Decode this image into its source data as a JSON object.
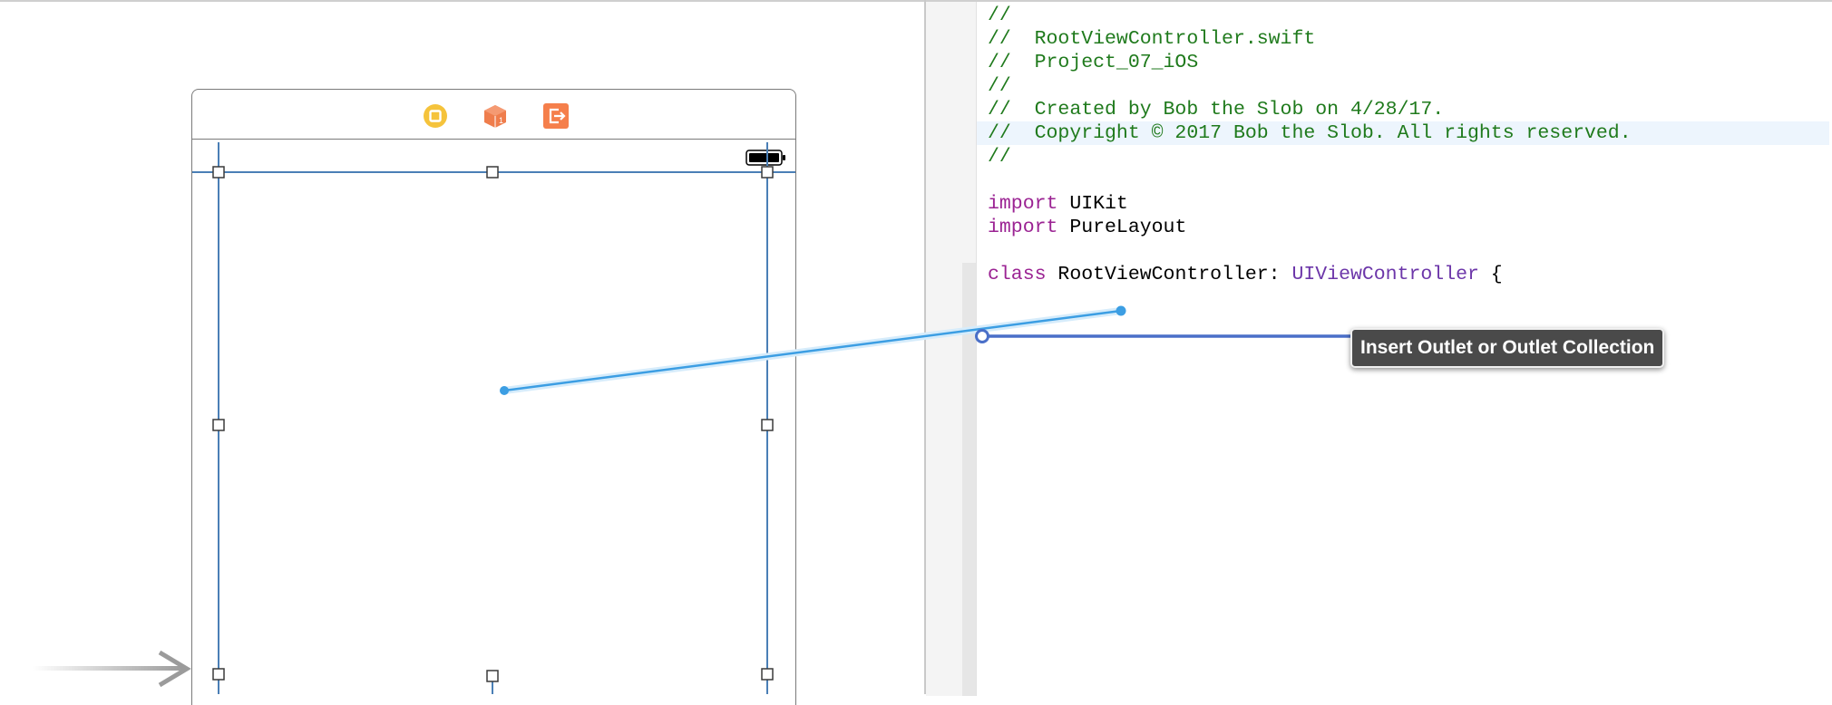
{
  "canvas": {
    "scene_dock_icons": [
      "view-controller-icon",
      "first-responder-icon",
      "exit-icon"
    ],
    "dock_icon_colors": {
      "view_controller": "#f5c33b",
      "first_responder": "#ef7d4c",
      "exit": "#f57f4b"
    },
    "selection_color": "#4a7fb6",
    "connection_color": "#3c9ee3"
  },
  "editor": {
    "code_lines": [
      {
        "parts": [
          {
            "t": "//",
            "c": "comment"
          }
        ]
      },
      {
        "parts": [
          {
            "t": "//  RootViewController.swift",
            "c": "comment"
          }
        ]
      },
      {
        "parts": [
          {
            "t": "//  Project_07_iOS",
            "c": "comment"
          }
        ]
      },
      {
        "parts": [
          {
            "t": "//",
            "c": "comment"
          }
        ]
      },
      {
        "parts": [
          {
            "t": "//  Created by Bob the Slob on 4/28/17.",
            "c": "comment"
          }
        ]
      },
      {
        "parts": [
          {
            "t": "//  Copyright © 2017 Bob the Slob. All rights reserved.",
            "c": "comment"
          }
        ],
        "highlight": true
      },
      {
        "parts": [
          {
            "t": "//",
            "c": "comment"
          }
        ]
      },
      {
        "parts": []
      },
      {
        "parts": [
          {
            "t": "import",
            "c": "keyword"
          },
          {
            "t": " UIKit",
            "c": "plain"
          }
        ]
      },
      {
        "parts": [
          {
            "t": "import",
            "c": "keyword"
          },
          {
            "t": " PureLayout",
            "c": "plain"
          }
        ]
      },
      {
        "parts": []
      },
      {
        "parts": [
          {
            "t": "class",
            "c": "keyword"
          },
          {
            "t": " RootViewController: ",
            "c": "plain"
          },
          {
            "t": "UIViewController",
            "c": "type"
          },
          {
            "t": " {",
            "c": "plain"
          }
        ]
      }
    ]
  },
  "tooltip": {
    "text": "Insert Outlet or Outlet Collection"
  }
}
